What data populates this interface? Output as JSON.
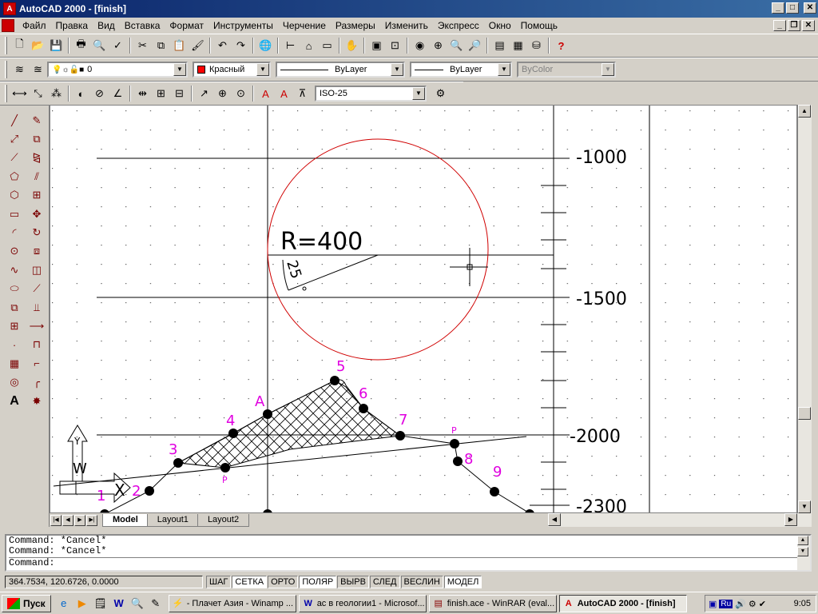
{
  "window": {
    "title": "AutoCAD 2000 - [finish]",
    "minimize": "_",
    "maximize": "□",
    "close": "✕",
    "doc_minimize": "_",
    "doc_restore": "❐",
    "doc_close": "✕"
  },
  "menu": [
    "Файл",
    "Правка",
    "Вид",
    "Вставка",
    "Формат",
    "Инструменты",
    "Черчение",
    "Размеры",
    "Изменить",
    "Экспресс",
    "Окно",
    "Помощь"
  ],
  "properties": {
    "layer": "0",
    "color": "Красный",
    "linetype": "ByLayer",
    "lineweight": "ByLayer",
    "plotstyle": "ByColor",
    "dimstyle": "ISO-25"
  },
  "drawing": {
    "y_ticks": [
      "-1000",
      "-1500",
      "-2000",
      "-2300"
    ],
    "radius_label": "R=400",
    "angle_label": "25",
    "point_labels": [
      "1",
      "2",
      "3",
      "4",
      "5",
      "6",
      "7",
      "8",
      "9",
      "A",
      "P",
      "P"
    ],
    "ucs_labels": {
      "y": "Y",
      "w": "W",
      "x": "X"
    }
  },
  "layout_tabs": [
    "Model",
    "Layout1",
    "Layout2"
  ],
  "command": {
    "lines": [
      "Command: *Cancel*",
      "Command: *Cancel*"
    ],
    "prompt": "Command:"
  },
  "status": {
    "coords": "364.7534, 120.6726, 0.0000",
    "toggles": [
      {
        "label": "ШАГ",
        "on": false
      },
      {
        "label": "СЕТКА",
        "on": true
      },
      {
        "label": "ОРТО",
        "on": false
      },
      {
        "label": "ПОЛЯР",
        "on": true
      },
      {
        "label": "ВЫРВ",
        "on": false
      },
      {
        "label": "СЛЕД",
        "on": false
      },
      {
        "label": "ВЕСЛИН",
        "on": false
      },
      {
        "label": "МОДЕЛ",
        "on": true
      }
    ]
  },
  "taskbar": {
    "start": "Пуск",
    "tasks": [
      {
        "label": "- Плачет Азия - Winamp ...",
        "icon": "winamp-icon",
        "active": false
      },
      {
        "label": "ас в геологии1 - Microsof...",
        "icon": "word-icon",
        "active": false
      },
      {
        "label": "finish.ace - WinRAR (eval...",
        "icon": "winrar-icon",
        "active": false
      },
      {
        "label": "AutoCAD 2000 - [finish]",
        "icon": "autocad-icon",
        "active": true
      }
    ],
    "lang": "Ru",
    "clock": "9:05"
  },
  "colors": {
    "circle": "#d00000",
    "labels": "#e000e0",
    "titlebar": "#0a246a"
  }
}
